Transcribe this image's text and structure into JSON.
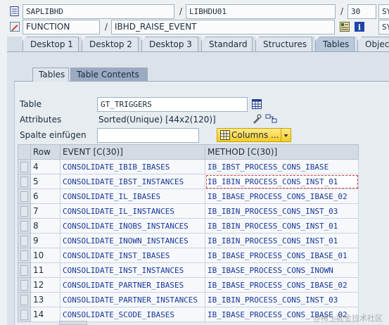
{
  "header": {
    "row1": {
      "program": "SAPLIBHD",
      "include": "LIBHDU01",
      "line": "30",
      "extra": "SY"
    },
    "row2": {
      "type": "FUNCTION",
      "name": "IBHD_RAISE_EVENT",
      "extra": "SY"
    }
  },
  "tabs": [
    {
      "label": "Desktop 1",
      "active": false
    },
    {
      "label": "Desktop 2",
      "active": false
    },
    {
      "label": "Desktop 3",
      "active": false
    },
    {
      "label": "Standard",
      "active": false
    },
    {
      "label": "Structures",
      "active": false
    },
    {
      "label": "Tables",
      "active": true
    },
    {
      "label": "Objec",
      "active": false
    }
  ],
  "subtabs": [
    {
      "label": "Tables",
      "active": false
    },
    {
      "label": "Table Contents",
      "active": true
    }
  ],
  "form": {
    "table_label": "Table",
    "table_value": "GT_TRIGGERS",
    "attributes_label": "Attributes",
    "attributes_value": "Sorted(Unique) [44x2(120)]",
    "insert_column_label": "Spalte einfügen",
    "insert_column_value": "",
    "columns_button": "Columns ..."
  },
  "grid": {
    "headers": {
      "row": "Row",
      "event": "EVENT [C(30)]",
      "method": "METHOD [C(30)]"
    },
    "rows": [
      {
        "row": "4",
        "event": "CONSOLIDATE_IBIB_IBASES",
        "method": "IB_IBST_PROCESS_CONS_IBASE"
      },
      {
        "row": "5",
        "event": "CONSOLIDATE_IBST_INSTANCES",
        "method": "IB_IBIN_PROCESS_CONS_INST_01"
      },
      {
        "row": "6",
        "event": "CONSOLIDATE_IL_IBASES",
        "method": "IB_IBASE_PROCESS_CONS_IBASE_02"
      },
      {
        "row": "7",
        "event": "CONSOLIDATE_IL_INSTANCES",
        "method": "IB_IBIN_PROCESS_CONS_INST_03"
      },
      {
        "row": "8",
        "event": "CONSOLIDATE_INOBS_INSTANCES",
        "method": "IB_IBIN_PROCESS_CONS_INST_01"
      },
      {
        "row": "9",
        "event": "CONSOLIDATE_INOWN_INSTANCES",
        "method": "IB_IBIN_PROCESS_CONS_INST_01"
      },
      {
        "row": "10",
        "event": "CONSOLIDATE_INST_IBASES",
        "method": "IB_IBASE_PROCESS_CONS_IBASE_01"
      },
      {
        "row": "11",
        "event": "CONSOLIDATE_INST_INSTANCES",
        "method": "IB_IBASE_PROCESS_CONS_INOWN"
      },
      {
        "row": "12",
        "event": "CONSOLIDATE_PARTNER_IBASES",
        "method": "IB_IBASE_PROCESS_CONS_IBASE_02"
      },
      {
        "row": "13",
        "event": "CONSOLIDATE_PARTNER_INSTANCES",
        "method": "IB_IBIN_PROCESS_CONS_INST_03"
      },
      {
        "row": "14",
        "event": "CONSOLIDATE_SCODE_IBASES",
        "method": "IB_IBASE_PROCESS_CONS_IBASE_02"
      }
    ]
  },
  "icons": {
    "program": "document-icon",
    "function": "pencil-icon",
    "source": "source-code-icon",
    "info": "info-icon",
    "table_picker": "table-icon",
    "attr_edit": "edit-icon",
    "attr_nav": "navigation-icon",
    "columns": "table-grid-icon",
    "dropdown": "dropdown-arrow-icon"
  },
  "watermark": "@稀土掘金技术社区"
}
